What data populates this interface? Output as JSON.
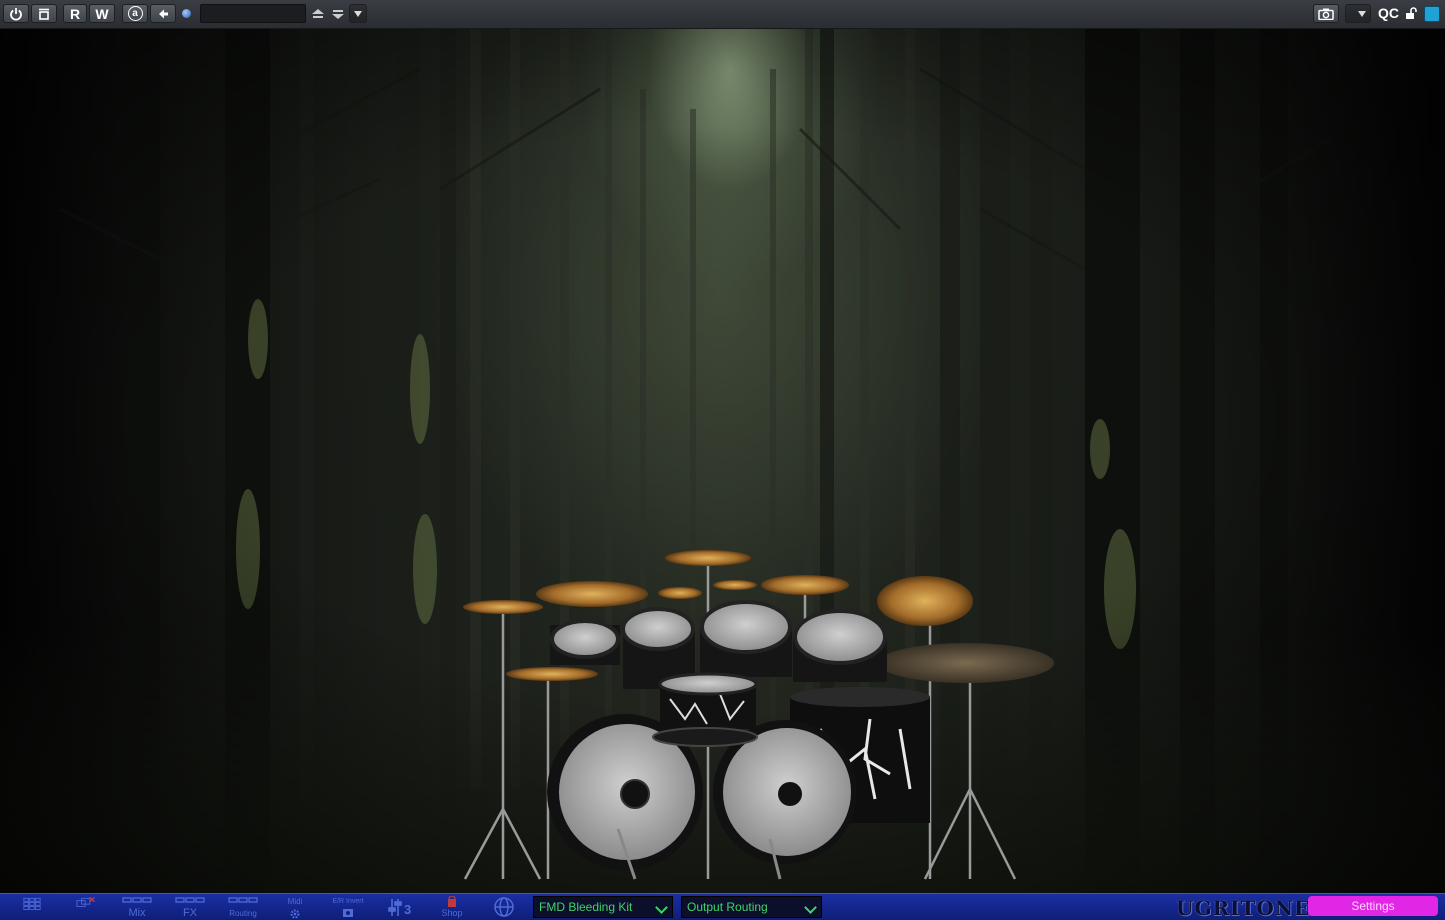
{
  "host_toolbar": {
    "power_icon": "power-icon",
    "compare_icon": "compare-icon",
    "read_label": "R",
    "write_label": "W",
    "auto_label": "a",
    "preset_value": "",
    "qc_label": "QC",
    "accent_color": "#1fa2d6"
  },
  "plugin_bar": {
    "nav": [
      {
        "label": "",
        "icon": "grid-icon"
      },
      {
        "label": "",
        "icon": "network-disconnect-icon"
      },
      {
        "label": "Mix",
        "icon": "mixer-icon"
      },
      {
        "label": "FX",
        "icon": "fx-icon"
      },
      {
        "label": "Routing",
        "icon": "routing-icon"
      },
      {
        "label": "Midi",
        "icon": "midi-gear-icon"
      },
      {
        "label": "E/R Invert",
        "icon": "invert-icon"
      },
      {
        "label": "",
        "icon": "sliders-icon"
      },
      {
        "label": "Shop",
        "icon": "shop-icon"
      },
      {
        "label": "",
        "icon": "globe-icon"
      }
    ],
    "kit_dropdown": "FMD Bleeding Kit",
    "routing_dropdown": "Output Routing",
    "brand": "UGRITONE",
    "settings_label": "Settings",
    "bar_color": "#1a2fa3",
    "settings_color": "#e226e6"
  }
}
